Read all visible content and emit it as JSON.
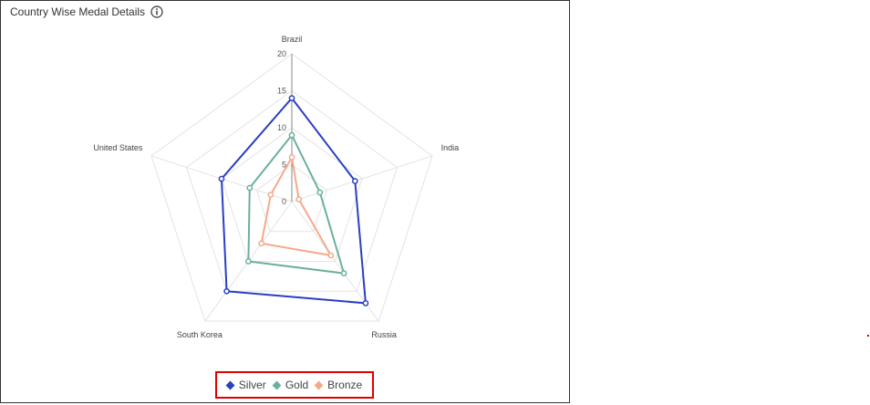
{
  "title": "Country Wise Medal Details",
  "icons": {
    "info": "info-icon"
  },
  "chart_data": {
    "type": "radar",
    "title": "Country Wise Medal Details",
    "categories": [
      "Brazil",
      "India",
      "Russia",
      "South Korea",
      "United States"
    ],
    "ticks": [
      "0",
      "5",
      "10",
      "15",
      "20"
    ],
    "range": [
      0,
      20
    ],
    "grid": true,
    "legend_position": "bottom",
    "series": [
      {
        "name": "Silver",
        "color": "#2a3fc2",
        "values": [
          14,
          9,
          17,
          15,
          10
        ]
      },
      {
        "name": "Gold",
        "color": "#6ab09a",
        "values": [
          9,
          4,
          12,
          10,
          6
        ]
      },
      {
        "name": "Bronze",
        "color": "#f5a98a",
        "values": [
          6,
          1,
          9,
          7,
          3
        ]
      }
    ]
  }
}
